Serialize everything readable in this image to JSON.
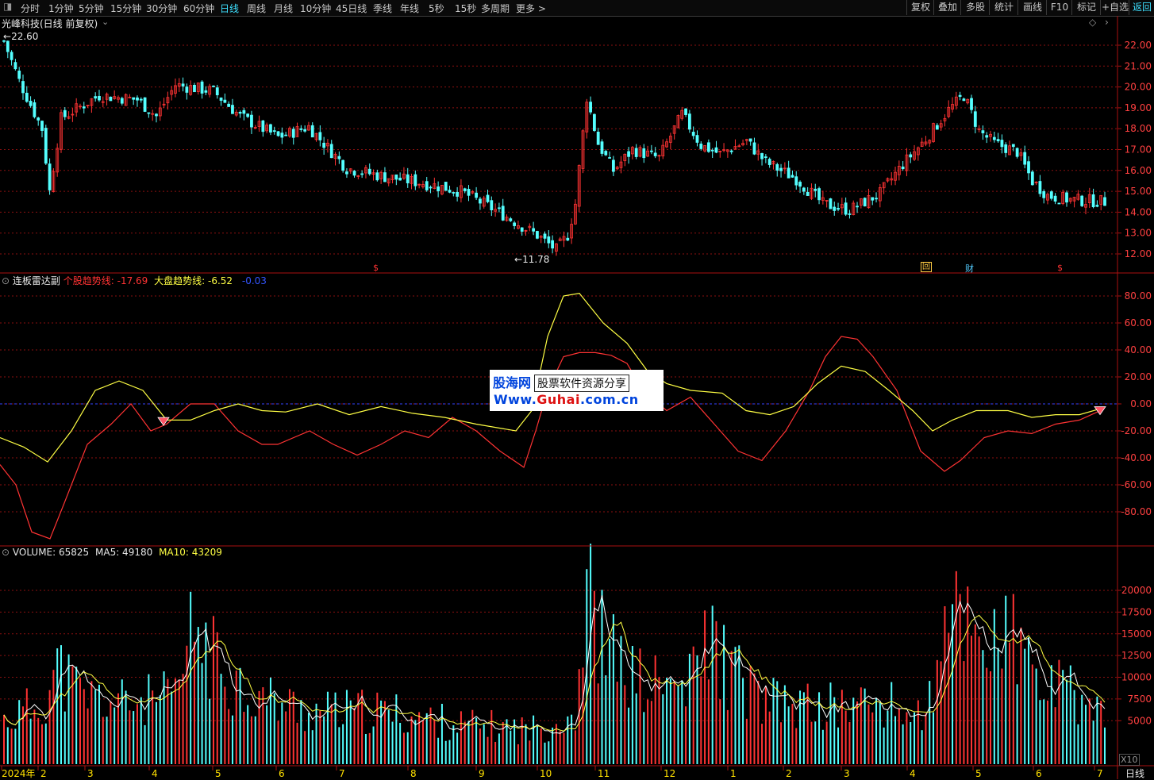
{
  "toolbar": {
    "periods": [
      "分时",
      "1分钟",
      "5分钟",
      "15分钟",
      "30分钟",
      "60分钟",
      "日线",
      "周线",
      "月线",
      "10分钟",
      "45日线",
      "季线",
      "年线",
      "5秒",
      "15秒",
      "多周期",
      "更多 >"
    ],
    "active_period": "日线",
    "right_buttons": [
      "复权",
      "叠加",
      "多股",
      "统计",
      "画线",
      "F10",
      "标记",
      "+自选",
      "返回"
    ]
  },
  "main_chart": {
    "title": "光峰科技(日线 前复权)",
    "high_marker": "22.60",
    "low_marker": "11.78",
    "event_marks": [
      "$",
      "回",
      "财",
      "$"
    ],
    "y_ticks": [
      "22.00",
      "21.00",
      "20.00",
      "19.00",
      "18.00",
      "17.00",
      "16.00",
      "15.00",
      "14.00",
      "13.00",
      "12.00"
    ]
  },
  "indicator": {
    "name": "连板雷达副",
    "line1_label": "个股趋势线:",
    "line1_value": "-17.69",
    "line2_label": "大盘趋势线:",
    "line2_value": "-6.52",
    "line3_value": "-0.03",
    "y_ticks": [
      "80.00",
      "60.00",
      "40.00",
      "20.00",
      "0.00",
      "-20.00",
      "-40.00",
      "-60.00",
      "-80.00"
    ]
  },
  "volume": {
    "label": "VOLUME: 65825",
    "ma5_label": "MA5: 49180",
    "ma10_label": "MA10: 43209",
    "y_ticks": [
      "20000",
      "17500",
      "15000",
      "12500",
      "10000",
      "7500",
      "5000"
    ],
    "unit": "X10"
  },
  "x_axis": {
    "labels": [
      "2024年",
      "2",
      "3",
      "4",
      "5",
      "6",
      "7",
      "8",
      "9",
      "10",
      "11",
      "12",
      "1",
      "2",
      "3",
      "4",
      "5",
      "6",
      "7"
    ],
    "period_label": "日线"
  },
  "watermark": {
    "brand": "股海网",
    "slogan": "股票软件资源分享",
    "url_prefix": "Www.",
    "url_domain": "Guhai",
    "url_suffix": ".com.cn"
  },
  "colors": {
    "up": "#ff3333",
    "down": "#54ffff",
    "yellow": "#ffff44",
    "grid": "#8b1010",
    "axis_text": "#ff4040"
  }
}
